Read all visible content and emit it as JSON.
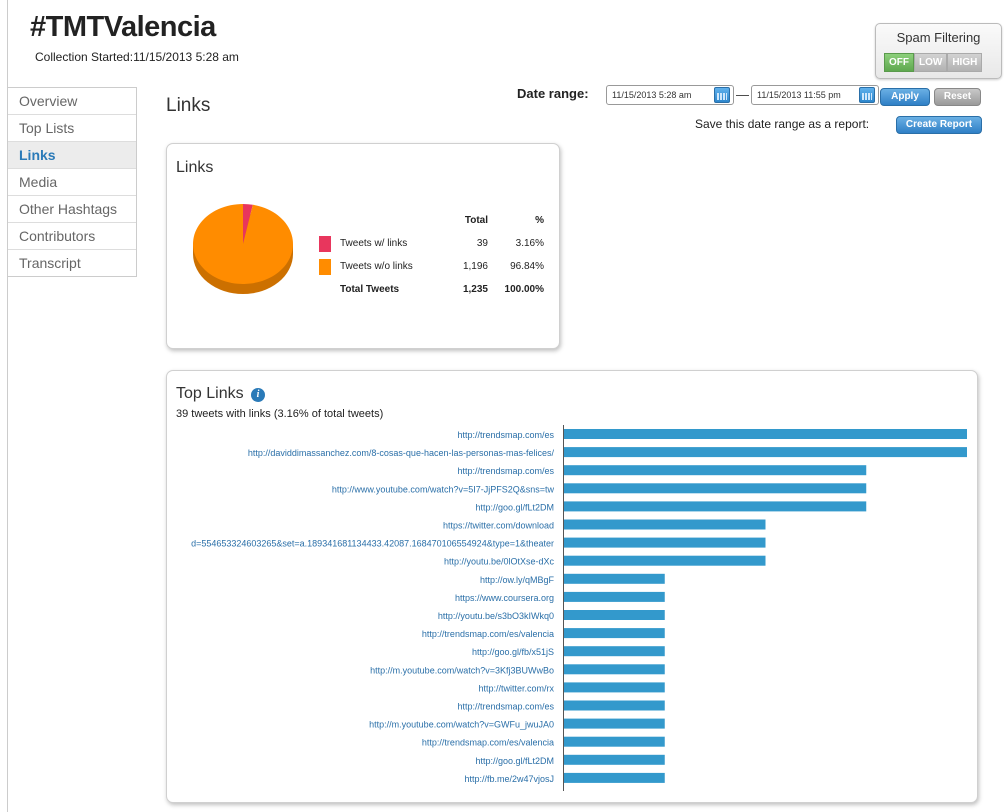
{
  "header": {
    "title": "#TMTValencia",
    "collection_label": "Collection Started:",
    "collection_value": "11/15/2013 5:28 am"
  },
  "spam": {
    "title": "Spam Filtering",
    "options": [
      "OFF",
      "LOW",
      "HIGH"
    ],
    "selected": "OFF"
  },
  "nav": {
    "items": [
      "Overview",
      "Top Lists",
      "Links",
      "Media",
      "Other Hashtags",
      "Contributors",
      "Transcript"
    ],
    "active": "Links"
  },
  "page_title": "Links",
  "date_range": {
    "label": "Date range:",
    "start": "11/15/2013 5:28 am",
    "end": "11/15/2013 11:55 pm",
    "separator": "—",
    "apply": "Apply",
    "reset": "Reset",
    "save_label": "Save this date range as a report:",
    "create": "Create Report"
  },
  "links_panel": {
    "title": "Links",
    "headers": {
      "total": "Total",
      "pct": "%"
    },
    "rows": [
      {
        "label": "Tweets w/ links",
        "total": "39",
        "pct": "3.16%",
        "color": "#e8365d"
      },
      {
        "label": "Tweets w/o links",
        "total": "1,196",
        "pct": "96.84%",
        "color": "#ff8c00"
      }
    ],
    "total_row": {
      "label": "Total Tweets",
      "total": "1,235",
      "pct": "100.00%"
    }
  },
  "top_links": {
    "title": "Top Links",
    "info_icon": "info-icon",
    "subtitle": "39 tweets with links (3.16% of total tweets)"
  },
  "chart_data": [
    {
      "type": "pie",
      "categories": [
        "Tweets w/ links",
        "Tweets w/o links"
      ],
      "values": [
        39,
        1196
      ],
      "colors": [
        "#e8365d",
        "#ff8c00"
      ]
    },
    {
      "type": "bar",
      "orientation": "horizontal",
      "bar_color": "#3399cc",
      "categories": [
        "http://trendsmap.com/es",
        "http://daviddimassanchez.com/8-cosas-que-hacen-las-personas-mas-felices/",
        "http://trendsmap.com/es",
        "http://www.youtube.com/watch?v=5I7-JjPFS2Q&sns=tw",
        "http://goo.gl/fLt2DM",
        "https://twitter.com/download",
        "d=554653324603265&set=a.189341681134433.42087.168470106554924&type=1&theater",
        "http://youtu.be/0lOtXse-dXc",
        "http://ow.ly/qMBgF",
        "https://www.coursera.org",
        "http://youtu.be/s3bO3kIWkq0",
        "http://trendsmap.com/es/valencia",
        "http://goo.gl/fb/x51jS",
        "http://m.youtube.com/watch?v=3Kfj3BUWwBo",
        "http://twitter.com/rx",
        "http://trendsmap.com/es",
        "http://m.youtube.com/watch?v=GWFu_jwuJA0",
        "http://trendsmap.com/es/valencia",
        "http://goo.gl/fLt2DM",
        "http://fb.me/2w47vjosJ"
      ],
      "values": [
        4,
        4,
        3,
        3,
        3,
        2,
        2,
        2,
        1,
        1,
        1,
        1,
        1,
        1,
        1,
        1,
        1,
        1,
        1,
        1
      ],
      "xlim": [
        0,
        4
      ]
    }
  ]
}
